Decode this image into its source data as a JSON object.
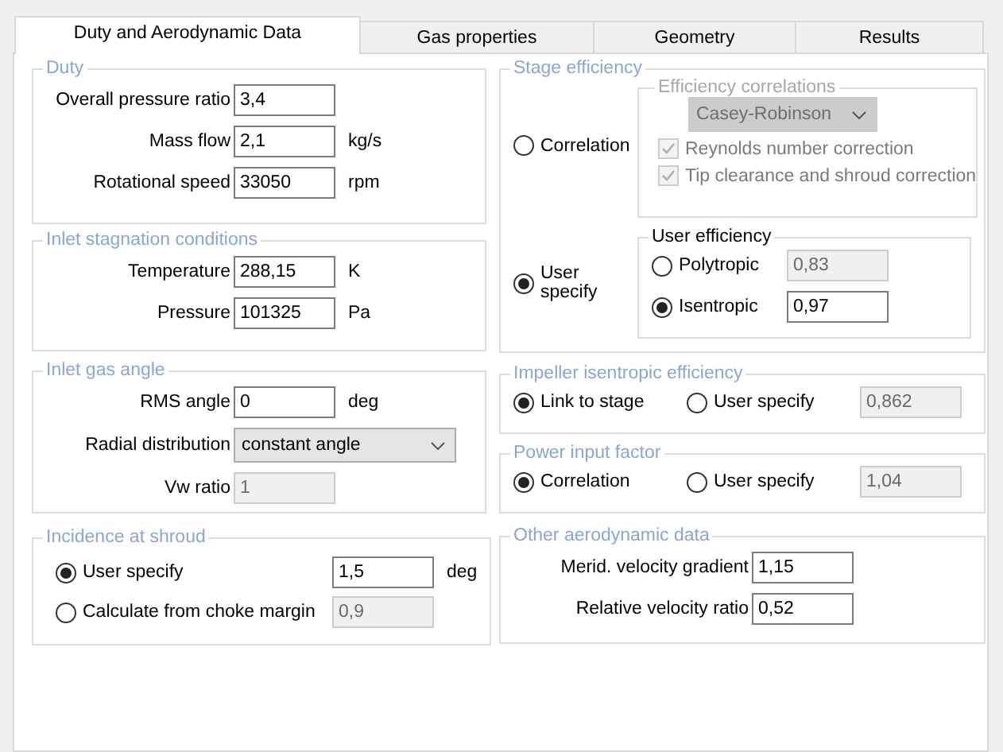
{
  "tabs": [
    {
      "label": "Duty and Aerodynamic Data",
      "selected": true
    },
    {
      "label": "Gas properties",
      "selected": false
    },
    {
      "label": "Geometry",
      "selected": false
    },
    {
      "label": "Results",
      "selected": false
    }
  ],
  "duty": {
    "title": "Duty",
    "rows": [
      {
        "kind": "field",
        "label": "Overall pressure ratio",
        "value": "3,4",
        "disabled": false
      },
      {
        "kind": "field",
        "label": "Mass flow",
        "value": "2,1",
        "unit": "kg/s",
        "disabled": false
      },
      {
        "kind": "field",
        "label": "Rotational speed",
        "value": "33050",
        "unit": "rpm",
        "disabled": false
      }
    ]
  },
  "inlet_stagnation": {
    "title": "Inlet stagnation conditions",
    "rows": [
      {
        "kind": "field",
        "label": "Temperature",
        "value": "288,15",
        "unit": "K",
        "disabled": false
      },
      {
        "kind": "field",
        "label": "Pressure",
        "value": "101325",
        "unit": "Pa",
        "disabled": false
      }
    ]
  },
  "inlet_gas_angle": {
    "title": "Inlet gas angle",
    "rows": [
      {
        "kind": "field",
        "label": "RMS angle",
        "value": "0",
        "unit": "deg",
        "disabled": false
      },
      {
        "kind": "dropdown",
        "label": "Radial distribution",
        "value": "constant angle",
        "disabled": false
      },
      {
        "kind": "field",
        "label": "Vw ratio",
        "value": "1",
        "disabled": true
      }
    ]
  },
  "incidence": {
    "title": "Incidence at shroud",
    "options": [
      {
        "label": "User specify",
        "selected": true,
        "value": "1,5",
        "unit": "deg",
        "disabled": false
      },
      {
        "label": "Calculate from choke margin",
        "selected": false,
        "value": "0,9",
        "disabled": true
      }
    ]
  },
  "stage_efficiency": {
    "title": "Stage efficiency",
    "options": [
      {
        "label": "Correlation",
        "selected": false
      },
      {
        "label": "User specify",
        "selected": true
      }
    ],
    "correlations": {
      "title": "Efficiency correlations",
      "disabled": true,
      "dropdown": "Casey-Robinson",
      "checks": [
        {
          "label": "Reynolds number correction",
          "checked": true
        },
        {
          "label": "Tip clearance and shroud correction",
          "checked": true
        }
      ]
    },
    "user_efficiency": {
      "title": "User efficiency",
      "options": [
        {
          "label": "Polytropic",
          "selected": false,
          "value": "0,83",
          "disabled": true
        },
        {
          "label": "Isentropic",
          "selected": true,
          "value": "0,97",
          "disabled": false
        }
      ]
    }
  },
  "impeller": {
    "title": "Impeller isentropic efficiency",
    "options": [
      {
        "label": "Link to stage",
        "selected": true
      },
      {
        "label": "User specify",
        "selected": false,
        "value": "0,862",
        "disabled": true
      }
    ]
  },
  "power_input": {
    "title": "Power input factor",
    "options": [
      {
        "label": "Correlation",
        "selected": true
      },
      {
        "label": "User specify",
        "selected": false,
        "value": "1,04",
        "disabled": true
      }
    ]
  },
  "other": {
    "title": "Other aerodynamic data",
    "rows": [
      {
        "kind": "field",
        "label": "Merid. velocity gradient",
        "value": "1,15",
        "disabled": false
      },
      {
        "kind": "field",
        "label": "Relative velocity ratio",
        "value": "0,52",
        "disabled": false
      }
    ]
  }
}
